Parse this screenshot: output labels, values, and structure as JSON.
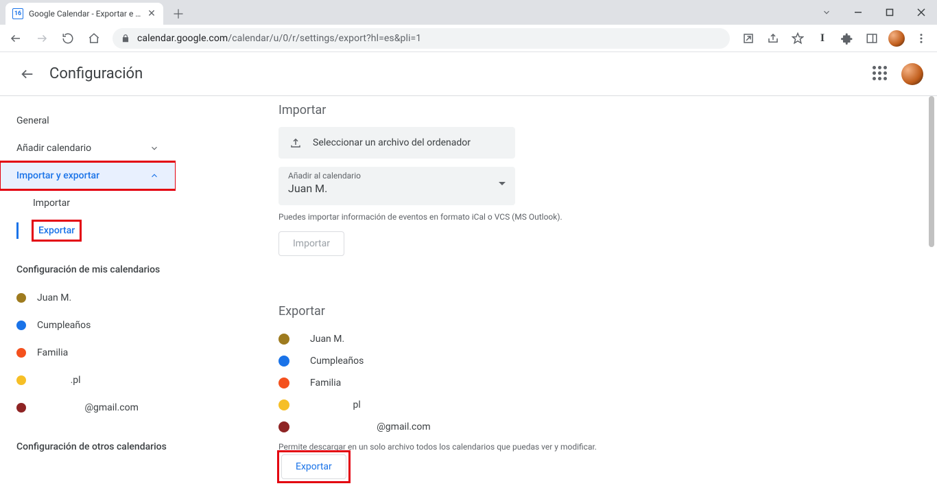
{
  "browser": {
    "tab_title": "Google Calendar - Exportar e imp",
    "url_host": "calendar.google.com",
    "url_path": "/calendar/u/0/r/settings/export?hl=es&pli=1"
  },
  "header": {
    "title": "Configuración"
  },
  "sidebar": {
    "general": "General",
    "add_calendar": "Añadir calendario",
    "import_export": "Importar y exportar",
    "sub_import": "Importar",
    "sub_export": "Exportar",
    "my_cal_heading": "Configuración de mis calendarios",
    "calendars": [
      {
        "label": "Juan M.",
        "color": "#9e7b1f"
      },
      {
        "label": "Cumpleaños",
        "color": "#1a73e8"
      },
      {
        "label": "Familia",
        "color": "#f4511e"
      },
      {
        "label": "              .pl",
        "color": "#f6bf26"
      },
      {
        "label": "                    @gmail.com",
        "color": "#8e2424"
      }
    ],
    "other_cal_heading": "Configuración de otros calendarios"
  },
  "import": {
    "heading": "Importar",
    "select_file": "Seleccionar un archivo del ordenador",
    "add_to_label": "Añadir al calendario",
    "add_to_value": "Juan M.",
    "hint": "Puedes importar información de eventos en formato iCal o VCS (MS Outlook).",
    "button": "Importar"
  },
  "export": {
    "heading": "Exportar",
    "calendars": [
      {
        "label": "Juan M.",
        "color": "#9e7b1f"
      },
      {
        "label": "Cumpleaños",
        "color": "#1a73e8"
      },
      {
        "label": "Familia",
        "color": "#f4511e"
      },
      {
        "label": "                  pl",
        "color": "#f6bf26"
      },
      {
        "label": "                            @gmail.com",
        "color": "#8e2424"
      }
    ],
    "hint": "Permite descargar en un solo archivo todos los calendarios que puedas ver y modificar.",
    "button": "Exportar"
  }
}
